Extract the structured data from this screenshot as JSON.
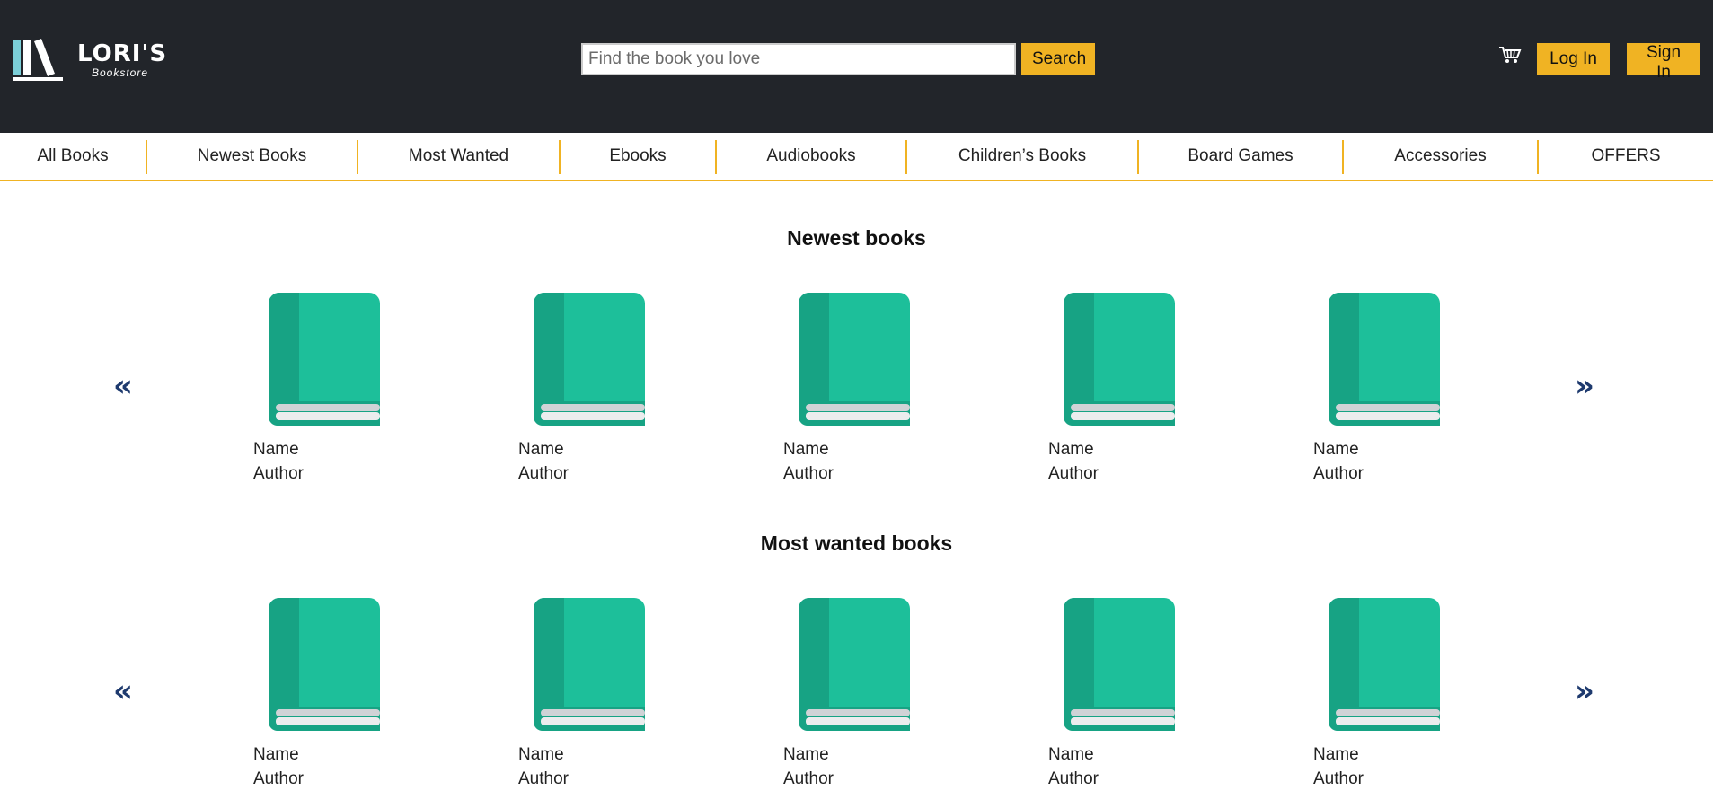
{
  "header": {
    "logo": {
      "title": "LORI'S",
      "subtitle": "Bookstore"
    },
    "search": {
      "placeholder": "Find the book you love",
      "value": "",
      "button_label": "Search"
    },
    "cart_icon": "cart-icon",
    "login_label": "Log In",
    "signin_label": "Sign In"
  },
  "nav": {
    "items": [
      {
        "label": "All Books"
      },
      {
        "label": "Newest Books"
      },
      {
        "label": "Most Wanted"
      },
      {
        "label": "Ebooks"
      },
      {
        "label": "Audiobooks"
      },
      {
        "label": "Children’s Books"
      },
      {
        "label": "Board Games"
      },
      {
        "label": "Accessories"
      },
      {
        "label": "OFFERS"
      }
    ]
  },
  "sections": [
    {
      "title": "Newest books",
      "prev_icon": "«",
      "next_icon": "»",
      "books": [
        {
          "name": "Name",
          "author": "Author"
        },
        {
          "name": "Name",
          "author": "Author"
        },
        {
          "name": "Name",
          "author": "Author"
        },
        {
          "name": "Name",
          "author": "Author"
        },
        {
          "name": "Name",
          "author": "Author"
        }
      ]
    },
    {
      "title": "Most wanted books",
      "prev_icon": "«",
      "next_icon": "»",
      "books": [
        {
          "name": "Name",
          "author": "Author"
        },
        {
          "name": "Name",
          "author": "Author"
        },
        {
          "name": "Name",
          "author": "Author"
        },
        {
          "name": "Name",
          "author": "Author"
        },
        {
          "name": "Name",
          "author": "Author"
        }
      ]
    }
  ],
  "colors": {
    "header_bg": "#22252a",
    "accent_yellow": "#f0b323",
    "book_cover": "#1dbf9a",
    "book_spine": "#17a384",
    "arrow": "#1e3a6e"
  }
}
